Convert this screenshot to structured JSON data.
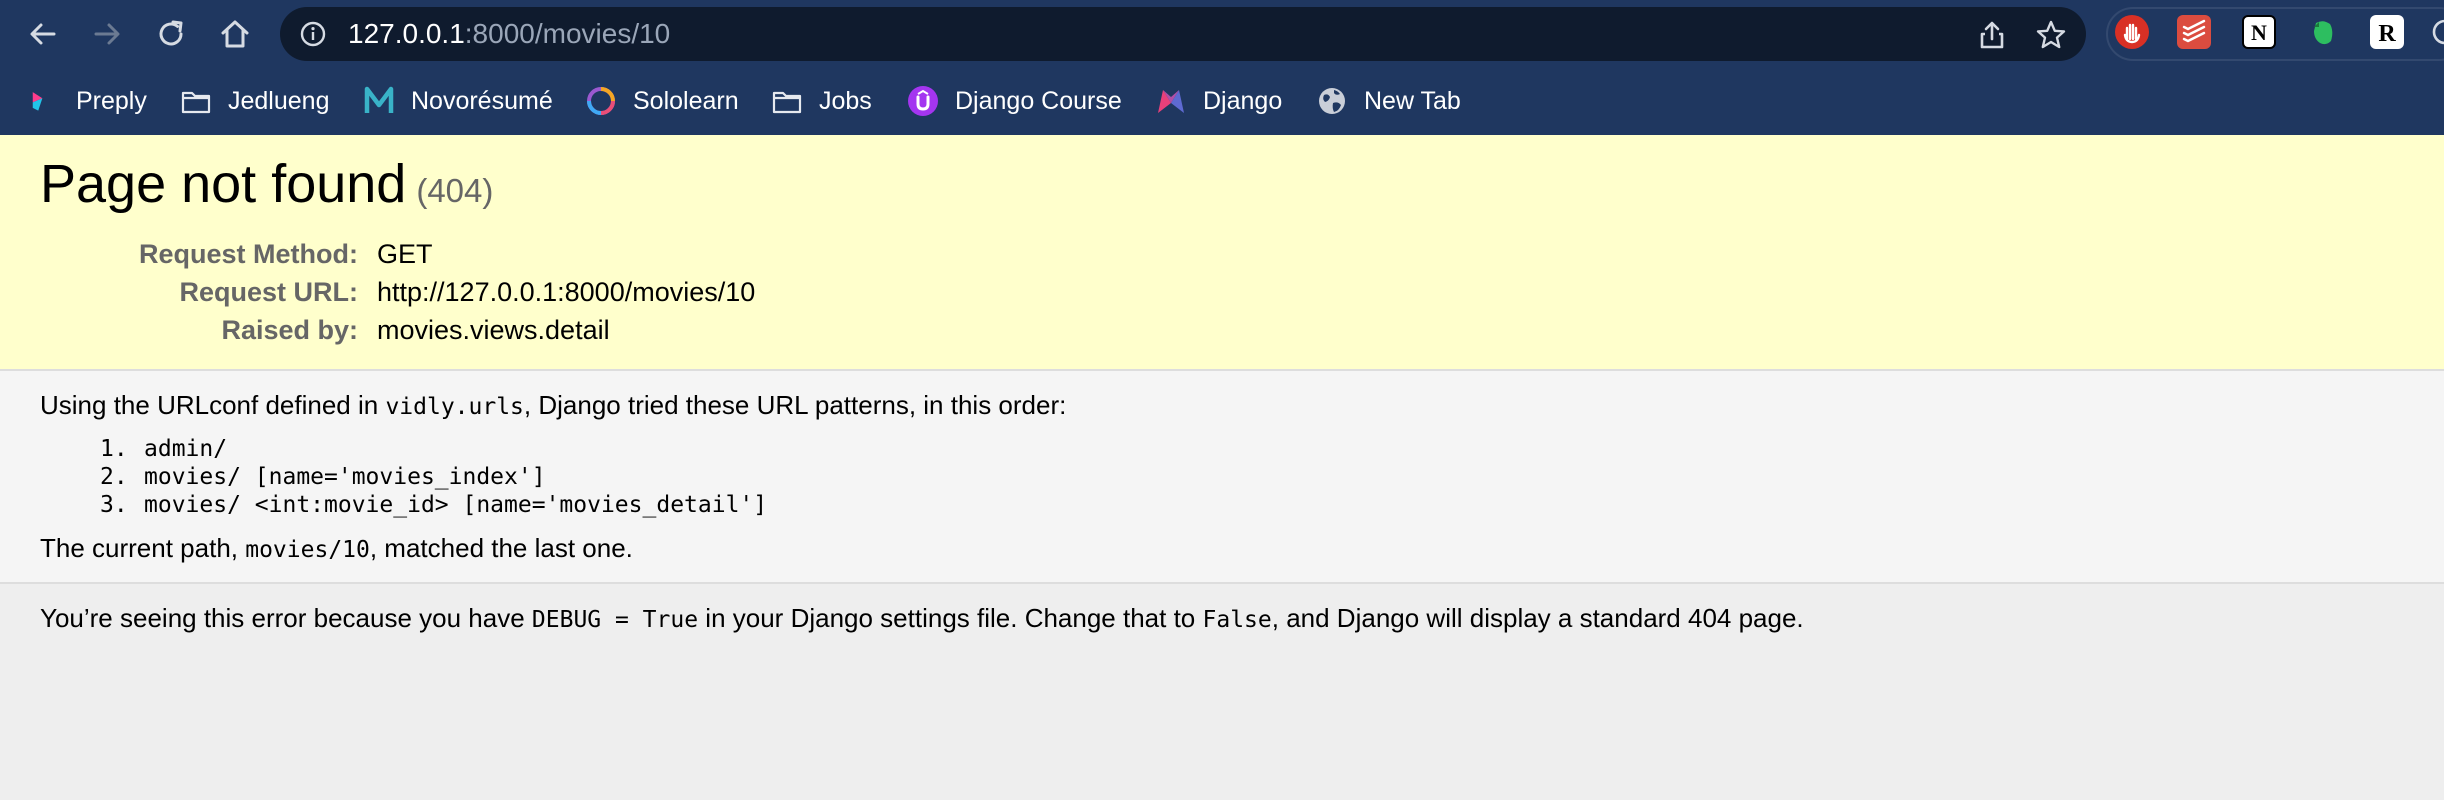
{
  "browser": {
    "url_host": "127.0.0.1",
    "url_rest": ":8000/movies/10",
    "bookmarks": [
      {
        "label": "Preply",
        "icon": "preply-icon"
      },
      {
        "label": "Jedlueng",
        "icon": "folder-icon"
      },
      {
        "label": "Novorésumé",
        "icon": "novoresume-icon"
      },
      {
        "label": "Sololearn",
        "icon": "sololearn-icon"
      },
      {
        "label": "Jobs",
        "icon": "folder-icon"
      },
      {
        "label": "Django Course",
        "icon": "udemy-icon"
      },
      {
        "label": "Django",
        "icon": "django-bookmark-icon"
      },
      {
        "label": "New Tab",
        "icon": "globe-icon"
      }
    ],
    "extensions": [
      "adblock-icon",
      "todoist-icon",
      "notion-icon",
      "evernote-icon",
      "readwise-icon"
    ]
  },
  "colors": {
    "chrome_bg": "#1f3760",
    "omnibox_bg": "#0f1b2e",
    "summary_bg": "#ffffcc",
    "info_bg": "#f5f5f5",
    "explanation_bg": "#eeeeee"
  },
  "page": {
    "title": "Page not found",
    "status_code": "(404)",
    "meta": [
      {
        "label": "Request Method:",
        "value": "GET"
      },
      {
        "label": "Request URL:",
        "value": "http://127.0.0.1:8000/movies/10"
      },
      {
        "label": "Raised by:",
        "value": "movies.views.detail"
      }
    ],
    "urlconf_prefix": "Using the URLconf defined in ",
    "urlconf_module": "vidly.urls",
    "urlconf_suffix": ", Django tried these URL patterns, in this order:",
    "patterns": [
      {
        "num": "1.",
        "text": "admin/"
      },
      {
        "num": "2.",
        "text": "movies/ [name='movies_index']"
      },
      {
        "num": "3.",
        "text": "movies/ <int:movie_id> [name='movies_detail']"
      }
    ],
    "current_path_prefix": "The current path, ",
    "current_path": "movies/10",
    "current_path_suffix": ", matched the last one.",
    "explanation": {
      "part1": "You’re seeing this error because you have ",
      "code1": "DEBUG = True",
      "part2": " in your Django settings file. Change that to ",
      "code2": "False",
      "part3": ", and Django will display a standard 404 page."
    }
  }
}
